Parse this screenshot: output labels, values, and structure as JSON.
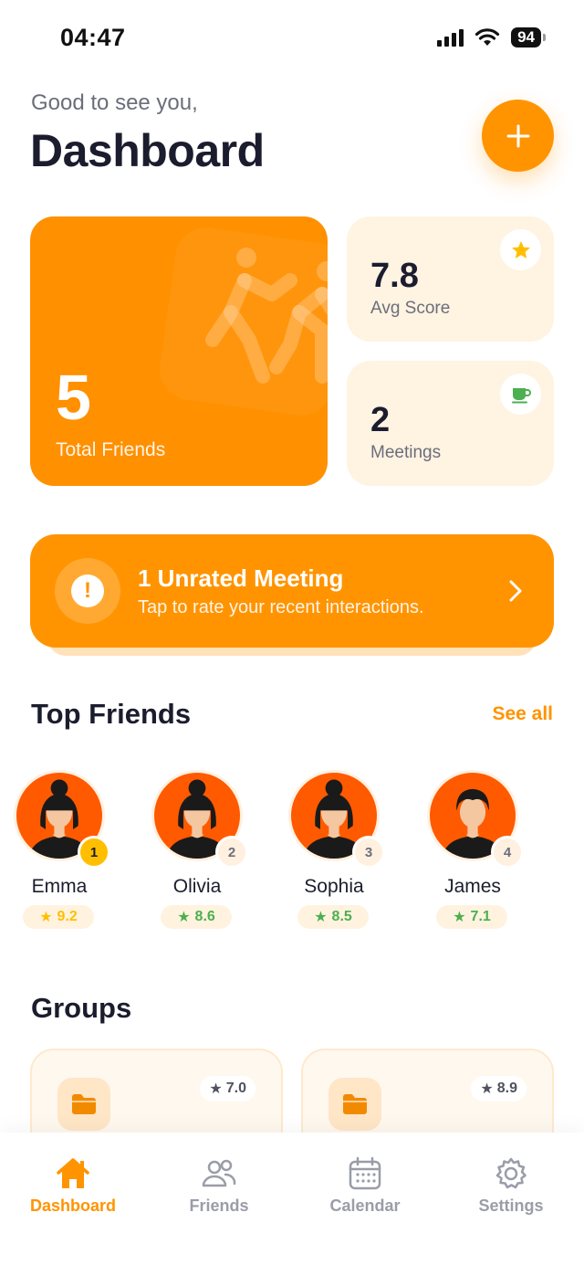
{
  "status_bar": {
    "time": "04:47",
    "battery": "94"
  },
  "header": {
    "greeting": "Good to see you,",
    "title": "Dashboard"
  },
  "stats": {
    "total_friends": {
      "value": "5",
      "label": "Total Friends"
    },
    "avg_score": {
      "value": "7.8",
      "label": "Avg Score",
      "icon": "star-icon"
    },
    "meetings": {
      "value": "2",
      "label": "Meetings",
      "icon": "coffee-icon"
    }
  },
  "unrated": {
    "title": "1 Unrated Meeting",
    "subtitle": "Tap to rate your recent interactions."
  },
  "top_friends": {
    "title": "Top Friends",
    "see_all": "See all",
    "items": [
      {
        "name": "Emma",
        "rank": "1",
        "score": "9.2",
        "star_color": "#ffbf00",
        "score_color": "#ffbf00",
        "avatar": "female"
      },
      {
        "name": "Olivia",
        "rank": "2",
        "score": "8.6",
        "star_color": "#4caf50",
        "score_color": "#4caf50",
        "avatar": "female"
      },
      {
        "name": "Sophia",
        "rank": "3",
        "score": "8.5",
        "star_color": "#4caf50",
        "score_color": "#4caf50",
        "avatar": "female"
      },
      {
        "name": "James",
        "rank": "4",
        "score": "7.1",
        "star_color": "#4caf50",
        "score_color": "#4caf50",
        "avatar": "male"
      }
    ]
  },
  "groups": {
    "title": "Groups",
    "items": [
      {
        "score": "7.0"
      },
      {
        "score": "8.9"
      }
    ]
  },
  "tabs": [
    {
      "label": "Dashboard",
      "icon": "home-icon",
      "active": true
    },
    {
      "label": "Friends",
      "icon": "people-icon",
      "active": false
    },
    {
      "label": "Calendar",
      "icon": "calendar-icon",
      "active": false
    },
    {
      "label": "Settings",
      "icon": "gear-icon",
      "active": false
    }
  ],
  "colors": {
    "accent": "#ff9400",
    "card_light": "#fff3e2",
    "text_dark": "#1b1d2e",
    "muted": "#6b6e7a"
  }
}
